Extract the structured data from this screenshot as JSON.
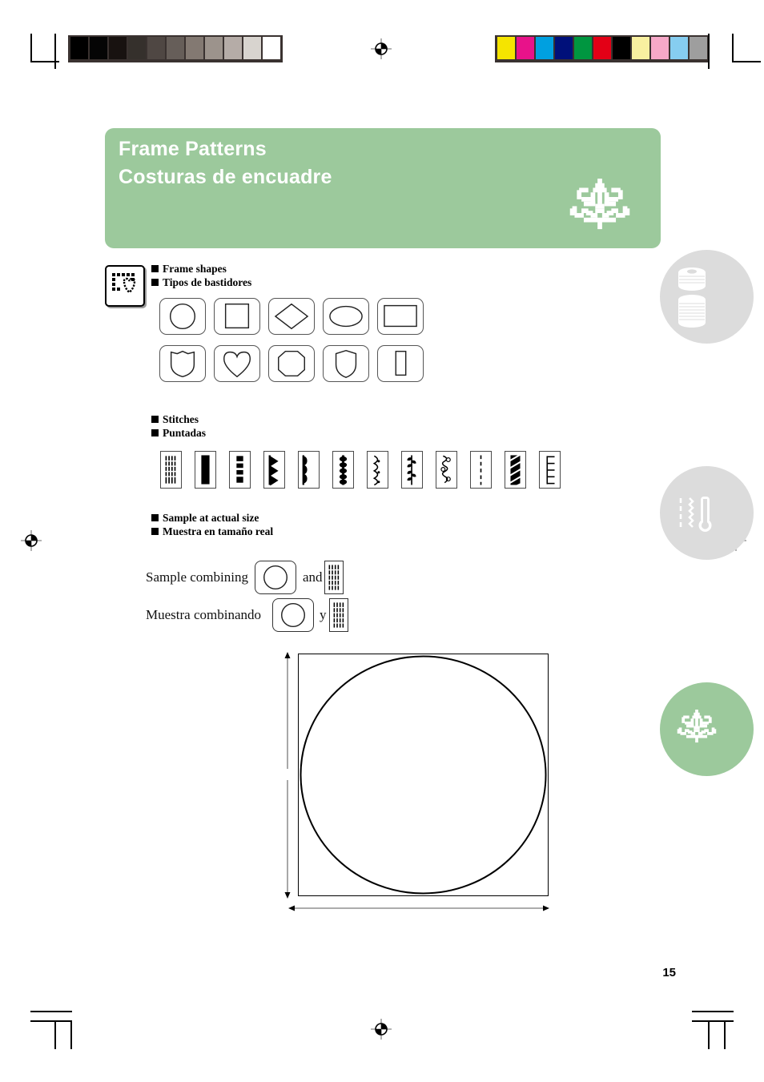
{
  "document": {
    "page_number": "15",
    "title_en": "Frame Patterns",
    "title_es": "Costuras de encuadre",
    "header_ornament_icon": "embroidery-flourish-icon"
  },
  "colors": {
    "brand_green": "#9cc99c",
    "bubble_gray": "#dcdcdc",
    "text_black": "#000000",
    "tile_outline": "#555555"
  },
  "sections": {
    "frame_shapes": {
      "label_en": "Frame shapes",
      "label_es": "Tipos de bastidores",
      "key_icon": "frame-shapes-button-icon",
      "shapes": [
        {
          "name": "circle",
          "icon": "circle-frame-icon"
        },
        {
          "name": "square",
          "icon": "square-frame-icon"
        },
        {
          "name": "diamond",
          "icon": "diamond-frame-icon"
        },
        {
          "name": "ellipse",
          "icon": "ellipse-frame-icon"
        },
        {
          "name": "rectangle",
          "icon": "rectangle-frame-icon"
        },
        {
          "name": "crest",
          "icon": "crest-frame-icon"
        },
        {
          "name": "heart",
          "icon": "heart-frame-icon"
        },
        {
          "name": "octagon",
          "icon": "octagon-frame-icon"
        },
        {
          "name": "shield",
          "icon": "shield-frame-icon"
        },
        {
          "name": "vertical-bar",
          "icon": "vertical-bar-frame-icon"
        }
      ]
    },
    "stitches": {
      "label_en": "Stitches",
      "label_es": "Puntadas",
      "items": [
        {
          "name": "multi-line-straight",
          "icon": "stitch-multiline-icon"
        },
        {
          "name": "solid-satin",
          "icon": "stitch-satin-icon"
        },
        {
          "name": "blocks",
          "icon": "stitch-blocks-icon"
        },
        {
          "name": "triangles",
          "icon": "stitch-triangle-icon"
        },
        {
          "name": "scallops",
          "icon": "stitch-scallop-icon"
        },
        {
          "name": "beads",
          "icon": "stitch-bead-icon"
        },
        {
          "name": "wave-dot",
          "icon": "stitch-wave-dot-icon"
        },
        {
          "name": "vine",
          "icon": "stitch-vine-icon"
        },
        {
          "name": "scroll",
          "icon": "stitch-scroll-icon"
        },
        {
          "name": "dashed",
          "icon": "stitch-dashed-icon"
        },
        {
          "name": "diagonal-fill",
          "icon": "stitch-diagonal-icon"
        },
        {
          "name": "ladder",
          "icon": "stitch-ladder-icon"
        }
      ]
    },
    "sample": {
      "label_en": "Sample at actual size",
      "label_es": "Muestra en tamaño real",
      "row_en": {
        "prefix": "Sample combining",
        "joiner": "and"
      },
      "row_es": {
        "prefix": "Muestra combinando",
        "joiner": "y"
      },
      "shape_icon": "circle-frame-icon",
      "stitch_icon": "stitch-multiline-icon",
      "drawing": {
        "icon": "circle-in-square-drawing",
        "width_dimension_icon": "horizontal-dimension-arrow",
        "height_dimension_icon": "vertical-dimension-arrow"
      }
    }
  },
  "side_bubbles": [
    {
      "name": "thread-spools-bubble",
      "icon": "thread-spool-icon",
      "style": "gray"
    },
    {
      "name": "needle-stitch-bubble",
      "icon": "needle-thermometer-icon",
      "style": "gray"
    },
    {
      "name": "ornament-bubble",
      "icon": "embroidery-flourish-icon",
      "style": "green"
    }
  ],
  "print_marks": {
    "grayscale_bar": [
      "#000000",
      "#050505",
      "#181210",
      "#35302c",
      "#4f4743",
      "#665e59",
      "#837972",
      "#9c938c",
      "#b5aca7",
      "#d8d4cf",
      "#ffffff"
    ],
    "color_bar": [
      "#f5e400",
      "#e8128a",
      "#00a0e0",
      "#00107a",
      "#009640",
      "#e30016",
      "#000000",
      "#f8f0a0",
      "#f6a8c8",
      "#86cdf0",
      "#9e9e9e"
    ],
    "registration_icon": "registration-target-icon",
    "crop_mark_icon": "crop-mark-icon"
  }
}
